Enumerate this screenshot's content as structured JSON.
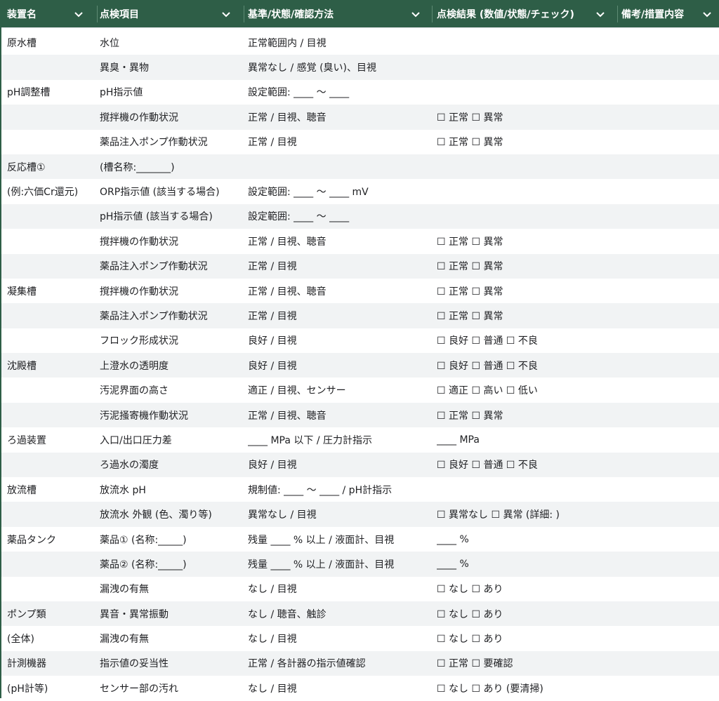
{
  "header": {
    "columns": [
      {
        "label": "装置名"
      },
      {
        "label": "点検項目"
      },
      {
        "label": "基準/状態/確認方法"
      },
      {
        "label": "点検結果 (数値/状態/チェック)"
      },
      {
        "label": "備考/措置内容"
      }
    ]
  },
  "rows": [
    [
      "原水槽",
      "水位",
      "正常範囲内 / 目視",
      "",
      ""
    ],
    [
      "",
      "異臭・異物",
      "異常なし / 感覚 (臭い)、目視",
      "",
      ""
    ],
    [
      "pH調整槽",
      "pH指示値",
      "設定範囲: ____ 〜 ____",
      "",
      ""
    ],
    [
      "",
      "撹拌機の作動状況",
      "正常 / 目視、聴音",
      "☐ 正常 ☐ 異常",
      ""
    ],
    [
      "",
      "薬品注入ポンプ作動状況",
      "正常 / 目視",
      "☐ 正常 ☐ 異常",
      ""
    ],
    [
      "反応槽①",
      "(槽名称:_______)",
      "",
      "",
      ""
    ],
    [
      "(例:六価Cr還元)",
      "ORP指示値 (該当する場合)",
      "設定範囲: ____ 〜 ____ mV",
      "",
      ""
    ],
    [
      "",
      "pH指示値 (該当する場合)",
      "設定範囲: ____ 〜 ____",
      "",
      ""
    ],
    [
      "",
      "撹拌機の作動状況",
      "正常 / 目視、聴音",
      "☐ 正常 ☐ 異常",
      ""
    ],
    [
      "",
      "薬品注入ポンプ作動状況",
      "正常 / 目視",
      "☐ 正常 ☐ 異常",
      ""
    ],
    [
      "凝集槽",
      "撹拌機の作動状況",
      "正常 / 目視、聴音",
      "☐ 正常 ☐ 異常",
      ""
    ],
    [
      "",
      "薬品注入ポンプ作動状況",
      "正常 / 目視",
      "☐ 正常 ☐ 異常",
      ""
    ],
    [
      "",
      "フロック形成状況",
      "良好 / 目視",
      "☐ 良好 ☐ 普通 ☐ 不良",
      ""
    ],
    [
      "沈殿槽",
      "上澄水の透明度",
      "良好 / 目視",
      "☐ 良好 ☐ 普通 ☐ 不良",
      ""
    ],
    [
      "",
      "汚泥界面の高さ",
      "適正 / 目視、センサー",
      "☐ 適正 ☐ 高い ☐ 低い",
      ""
    ],
    [
      "",
      "汚泥掻寄機作動状況",
      "正常 / 目視、聴音",
      "☐ 正常 ☐ 異常",
      ""
    ],
    [
      "ろ過装置",
      "入口/出口圧力差",
      "____ MPa 以下 / 圧力計指示",
      "____ MPa",
      ""
    ],
    [
      "",
      "ろ過水の濁度",
      "良好 / 目視",
      "☐ 良好 ☐ 普通 ☐ 不良",
      ""
    ],
    [
      "放流槽",
      "放流水 pH",
      "規制値: ____ 〜 ____ / pH計指示",
      "",
      ""
    ],
    [
      "",
      "放流水 外観 (色、濁り等)",
      "異常なし / 目視",
      "☐ 異常なし ☐ 異常 (詳細: )",
      ""
    ],
    [
      "薬品タンク",
      "薬品① (名称:_____)",
      "残量 ____ % 以上 / 液面計、目視",
      "____ %",
      ""
    ],
    [
      "",
      "薬品② (名称:_____)",
      "残量 ____ % 以上 / 液面計、目視",
      "____ %",
      ""
    ],
    [
      "",
      "漏洩の有無",
      "なし / 目視",
      "☐ なし ☐ あり",
      ""
    ],
    [
      "ポンプ類",
      "異音・異常振動",
      "なし / 聴音、触診",
      "☐ なし ☐ あり",
      ""
    ],
    [
      "(全体)",
      "漏洩の有無",
      "なし / 目視",
      "☐ なし ☐ あり",
      ""
    ],
    [
      "計測機器",
      "指示値の妥当性",
      "正常 / 各計器の指示値確認",
      "☐ 正常 ☐ 要確認",
      ""
    ],
    [
      "(pH計等)",
      "センサー部の汚れ",
      "なし / 目視",
      "☐ なし ☐ あり (要清掃)",
      ""
    ]
  ],
  "colors": {
    "header_bg": "#2e5e47",
    "header_text": "#ffffff",
    "row_alt": "#f1f3f4"
  },
  "icons": {
    "column_menu": "chevron-down-icon"
  }
}
